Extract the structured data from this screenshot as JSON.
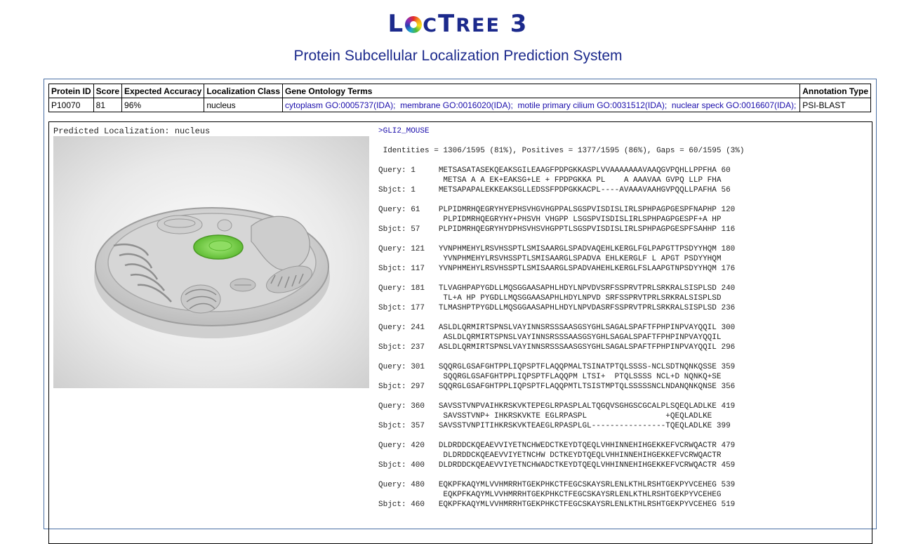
{
  "header": {
    "logo_lead": "L",
    "logo_tail": "C",
    "logo_tree": "T",
    "logo_tree_rest": "REE",
    "logo_num": "3",
    "subtitle": "Protein Subcellular Localization Prediction System"
  },
  "table": {
    "headers": [
      "Protein ID",
      "Score",
      "Expected Accuracy",
      "Localization Class",
      "Gene Ontology Terms",
      "Annotation Type"
    ],
    "row": {
      "protein_id": "P10070",
      "score": "81",
      "accuracy": "96%",
      "class": "nucleus",
      "go_terms": [
        "cytoplasm GO:0005737(IDA);",
        "membrane GO:0016020(IDA);",
        "motile primary cilium GO:0031512(IDA);",
        "nuclear speck GO:0016607(IDA);"
      ],
      "annotation_type": "PSI-BLAST"
    }
  },
  "prediction": {
    "label": "Predicted Localization: nucleus"
  },
  "alignment": {
    "hit_name": ">GLI2_MOUSE",
    "stats": " Identities = 1306/1595 (81%), Positives = 1377/1595 (86%), Gaps = 60/1595 (3%)",
    "blocks": [
      [
        "Query: 1     METSASATASEKQEAKSGILEAAGFPDPGKKASPLVVAAAAAAAVAAQGVPQHLLPPFHA 60",
        "              METSA A A EK+EAKSG+LE + FPDPGKKA PL    A AAAVAA GVPQ LLP FHA",
        "Sbjct: 1     METSAPAPALEKKEAKSGLLEDSSFPDPGKKACPL----AVAAAVAAHGVPQQLLPAFHA 56"
      ],
      [
        "Query: 61    PLPIDMRHQEGRYHYEPHSVHGVHGPPALSGSPVISDISLIRLSPHPAGPGESPFNAPHP 120",
        "              PLPIDMRHQEGRYHY+PHSVH VHGPP LSGSPVISDISLIRLSPHPAGPGESPF+A HP",
        "Sbjct: 57    PLPIDMRHQEGRYHYDPHSVHSVHGPPTLSGSPVISDISLIRLSPHPAGPGESPFSAHHP 116"
      ],
      [
        "Query: 121   YVNPHMEHYLRSVHSSPTLSMISAARGLSPADVAQEHLKERGLFGLPAPGTTPSDYYHQM 180",
        "              YVNPHMEHYLRSVHSSPTLSMISAARGLSPADVA EHLKERGLF L APGT PSDYYHQM",
        "Sbjct: 117   YVNPHMEHYLRSVHSSPTLSMISAARGLSPADVAHEHLKERGLFSLAAPGTNPSDYYHQM 176"
      ],
      [
        "Query: 181   TLVAGHPAPYGDLLMQSGGAASAPHLHDYLNPVDVSRFSSPRVTPRLSRKRALSISPLSD 240",
        "              TL+A HP PYGDLLMQSGGAASAPHLHDYLNPVD SRFSSPRVTPRLSRKRALSISPLSD",
        "Sbjct: 177   TLMASHPTPYGDLLMQSGGAASAPHLHDYLNPVDASRFSSPRVTPRLSRKRALSISPLSD 236"
      ],
      [
        "Query: 241   ASLDLQRMIRTSPNSLVAYINNSRSSSAASGSYGHLSAGALSPAFTFPHPINPVAYQQIL 300",
        "              ASLDLQRMIRTSPNSLVAYINNSRSSSAASGSYGHLSAGALSPAFTFPHPINPVAYQQIL",
        "Sbjct: 237   ASLDLQRMIRTSPNSLVAYINNSRSSSAASGSYGHLSAGALSPAFTFPHPINPVAYQQIL 296"
      ],
      [
        "Query: 301   SQQRGLGSAFGHTPPLIQPSPTFLAQQPMALTSINATPTQLSSSS-NCLSDTNQNKQSSE 359",
        "              SQQRGLGSAFGHTPPLIQPSPTFLAQQPM LTSI+  PTQLSSSS NCL+D NQNKQ+SE",
        "Sbjct: 297   SQQRGLGSAFGHTPPLIQPSPTFLAQQPMTLTSISTMPTQLSSSSSNCLNDANQNKQNSE 356"
      ],
      [
        "Query: 360   SAVSSTVNPVAIHKRSKVKTEPEGLRPASPLALTQGQVSGHGSCGCALPLSQEQLADLKE 419",
        "              SAVSSTVNP+ IHKRSKVKTE EGLRPASPL                 +QEQLADLKE",
        "Sbjct: 357   SAVSSTVNPITIHKRSKVKTEAEGLRPASPLGL----------------TQEQLADLKE 399"
      ],
      [
        "Query: 420   DLDRDDCKQEAEVVIYETNCHWEDCTKEYDTQEQLVHHINNEHIHGEKKEFVCRWQACTR 479",
        "              DLDRDDCKQEAEVVIYETNCHW DCTKEYDTQEQLVHHINNEHIHGEKKEFVCRWQACTR",
        "Sbjct: 400   DLDRDDCKQEAEVVIYETNCHWADCTKEYDTQEQLVHHINNEHIHGEKKEFVCRWQACTR 459"
      ],
      [
        "Query: 480   EQKPFKAQYMLVVHMRRHTGEKPHKCTFEGCSKAYSRLENLKTHLRSHTGEKPYVCEHEG 539",
        "              EQKPFKAQYMLVVHMRRHTGEKPHKCTFEGCSKAYSRLENLKTHLRSHTGEKPYVCEHEG",
        "Sbjct: 460   EQKPFKAQYMLVVHMRRHTGEKPHKCTFEGCSKAYSRLENLKTHLRSHTGEKPYVCEHEG 519"
      ]
    ]
  },
  "colors": {
    "brand": "#1c2a8c",
    "link": "#1a0dab",
    "nucleus": "#7ed957",
    "border": "#4a6fa5"
  }
}
